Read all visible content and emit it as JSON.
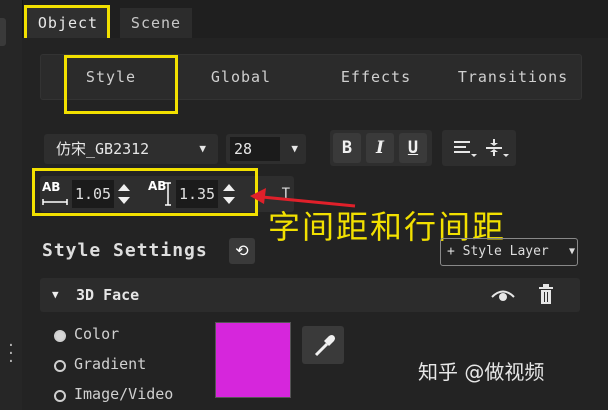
{
  "top_tabs": {
    "object": "Object",
    "scene": "Scene"
  },
  "sub_tabs": [
    "Style",
    "Global",
    "Effects",
    "Transitions"
  ],
  "font": {
    "family": "仿宋_GB2312",
    "size": "28"
  },
  "format_buttons": {
    "bold": "B",
    "italic": "I",
    "underline": "U"
  },
  "spacing": {
    "char_label": "AB",
    "char_value": "1.05",
    "line_label": "AB",
    "line_value": "1.35"
  },
  "style_settings": {
    "title": "Style Settings",
    "add_layer": "+ Style Layer"
  },
  "face": {
    "title": "3D Face"
  },
  "fill_options": [
    "Color",
    "Gradient",
    "Image/Video"
  ],
  "fill_selected": "Color",
  "swatch_color": "#d626dc",
  "highlight_color": "#f2e000",
  "arrow_color": "#e0202a",
  "annotation": "字间距和行间距",
  "watermark": "知乎 @做视频"
}
